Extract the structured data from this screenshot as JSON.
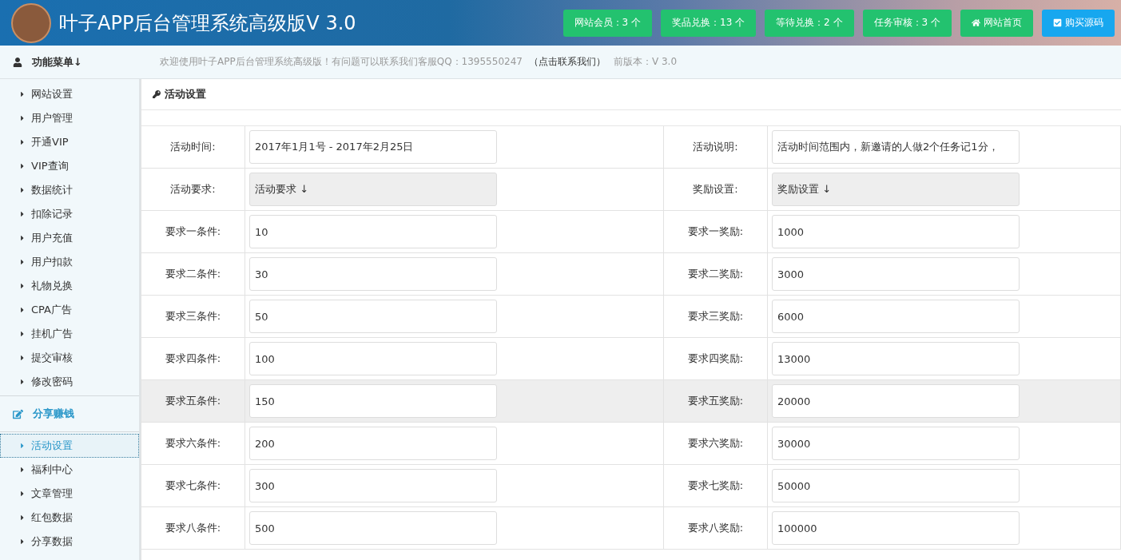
{
  "header": {
    "title": "叶子APP后台管理系统高级版V 3.0",
    "buttons": [
      {
        "kind": "stat",
        "label": "网站会员：3 个"
      },
      {
        "kind": "stat",
        "label": "奖品兑换：13 个"
      },
      {
        "kind": "stat",
        "label": "等待兑换：2 个"
      },
      {
        "kind": "stat",
        "label": "任务审核：3 个"
      },
      {
        "kind": "home",
        "label": "网站首页"
      },
      {
        "kind": "buy",
        "label": "购买源码"
      }
    ]
  },
  "notice": {
    "text": "欢迎使用叶子APP后台管理系统高级版！有问题可以联系我们客服QQ：1395550247",
    "link": "（点击联系我们）",
    "version": "前版本：V 3.0"
  },
  "sidebar": {
    "groups": [
      {
        "kind": "menu",
        "title": "功能菜单↓",
        "items": [
          {
            "label": "网站设置",
            "selected": false
          },
          {
            "label": "用户管理",
            "selected": false
          },
          {
            "label": "开通VIP",
            "selected": false
          },
          {
            "label": "VIP查询",
            "selected": false
          },
          {
            "label": "数据统计",
            "selected": false
          },
          {
            "label": "扣除记录",
            "selected": false
          },
          {
            "label": "用户充值",
            "selected": false
          },
          {
            "label": "用户扣款",
            "selected": false
          },
          {
            "label": "礼物兑换",
            "selected": false
          },
          {
            "label": "CPA广告",
            "selected": false
          },
          {
            "label": "挂机广告",
            "selected": false
          },
          {
            "label": "提交审核",
            "selected": false
          },
          {
            "label": "修改密码",
            "selected": false
          }
        ]
      },
      {
        "kind": "share",
        "title": "分享赚钱",
        "items": [
          {
            "label": "活动设置",
            "selected": true
          },
          {
            "label": "福利中心",
            "selected": false
          },
          {
            "label": "文章管理",
            "selected": false
          },
          {
            "label": "红包数据",
            "selected": false
          },
          {
            "label": "分享数据",
            "selected": false
          }
        ]
      }
    ]
  },
  "panel": {
    "title": "活动设置",
    "rows": [
      {
        "kind": "input",
        "hovered": false,
        "left_label": "活动时间:",
        "left_value": "2017年1月1号 - 2017年2月25日",
        "right_label": "活动说明:",
        "right_value": "活动时间范围内，新邀请的人做2个任务记1分，"
      },
      {
        "kind": "readonly",
        "hovered": false,
        "left_label": "活动要求:",
        "left_value": "活动要求 ↓",
        "right_label": "奖励设置:",
        "right_value": "奖励设置 ↓"
      },
      {
        "kind": "input",
        "hovered": false,
        "left_label": "要求一条件:",
        "left_value": "10",
        "right_label": "要求一奖励:",
        "right_value": "1000"
      },
      {
        "kind": "input",
        "hovered": false,
        "left_label": "要求二条件:",
        "left_value": "30",
        "right_label": "要求二奖励:",
        "right_value": "3000"
      },
      {
        "kind": "input",
        "hovered": false,
        "left_label": "要求三条件:",
        "left_value": "50",
        "right_label": "要求三奖励:",
        "right_value": "6000"
      },
      {
        "kind": "input",
        "hovered": false,
        "left_label": "要求四条件:",
        "left_value": "100",
        "right_label": "要求四奖励:",
        "right_value": "13000"
      },
      {
        "kind": "input",
        "hovered": true,
        "left_label": "要求五条件:",
        "left_value": "150",
        "right_label": "要求五奖励:",
        "right_value": "20000"
      },
      {
        "kind": "input",
        "hovered": false,
        "left_label": "要求六条件:",
        "left_value": "200",
        "right_label": "要求六奖励:",
        "right_value": "30000"
      },
      {
        "kind": "input",
        "hovered": false,
        "left_label": "要求七条件:",
        "left_value": "300",
        "right_label": "要求七奖励:",
        "right_value": "50000"
      },
      {
        "kind": "input",
        "hovered": false,
        "left_label": "要求八条件:",
        "left_value": "500",
        "right_label": "要求八奖励:",
        "right_value": "100000"
      }
    ]
  }
}
